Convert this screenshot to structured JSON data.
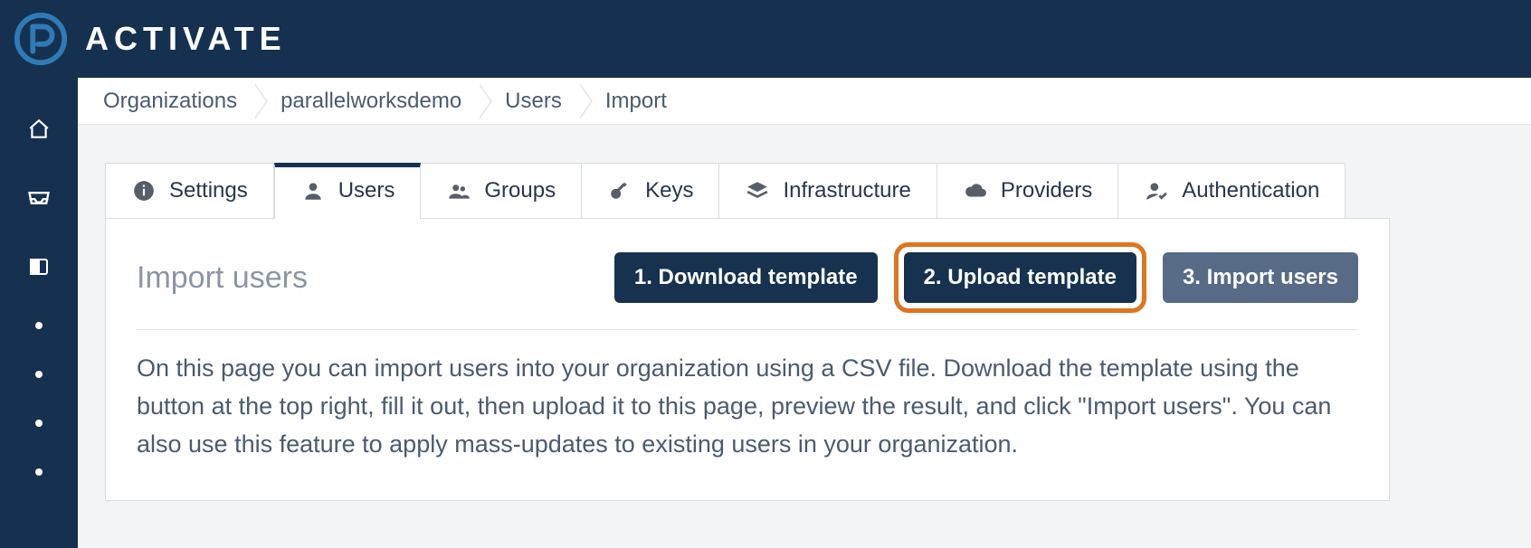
{
  "brand": {
    "title": "ACTIVATE"
  },
  "breadcrumb": [
    {
      "label": "Organizations"
    },
    {
      "label": "parallelworksdemo"
    },
    {
      "label": "Users"
    },
    {
      "label": "Import"
    }
  ],
  "tabs": [
    {
      "label": "Settings",
      "icon": "info-icon"
    },
    {
      "label": "Users",
      "icon": "user-icon",
      "active": true
    },
    {
      "label": "Groups",
      "icon": "group-icon"
    },
    {
      "label": "Keys",
      "icon": "key-icon"
    },
    {
      "label": "Infrastructure",
      "icon": "layers-icon"
    },
    {
      "label": "Providers",
      "icon": "cloud-icon"
    },
    {
      "label": "Authentication",
      "icon": "user-check-icon"
    }
  ],
  "panel": {
    "title": "Import users",
    "steps": [
      {
        "label": "1. Download template",
        "variant": "primary"
      },
      {
        "label": "2. Upload template",
        "variant": "primary",
        "highlighted": true
      },
      {
        "label": "3. Import users",
        "variant": "muted"
      }
    ],
    "body": "On this page you can import users into your organization using a CSV file. Download the template using the button at the top right, fill it out, then upload it to this page, preview the result, and click \"Import users\". You can also use this feature to apply mass-updates to existing users in your organization."
  },
  "sidebar_dots": 4
}
